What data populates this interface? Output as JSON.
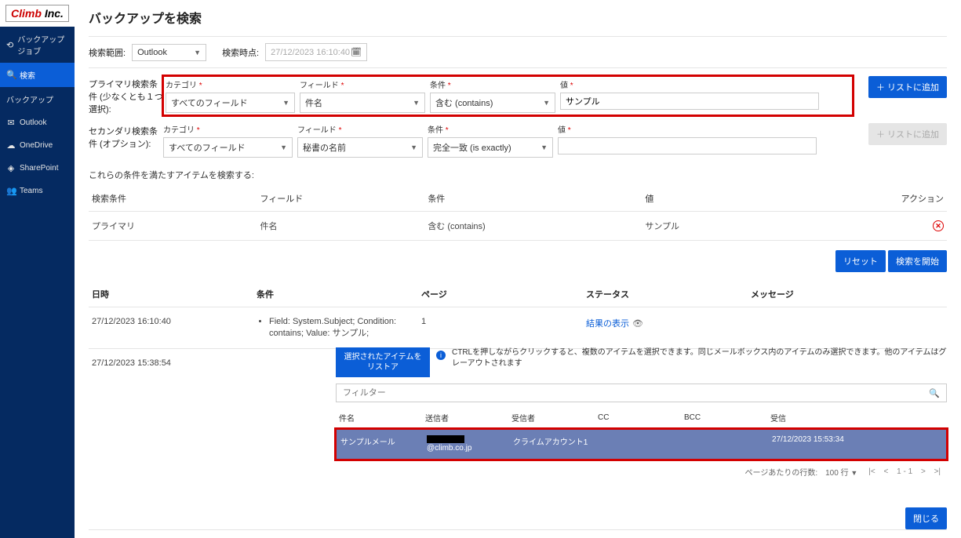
{
  "logo": {
    "red": "Climb",
    "black": "Inc."
  },
  "nav": {
    "backupJob": "バックアップジョブ",
    "search": "検索",
    "backup": "バックアップ",
    "outlook": "Outlook",
    "onedrive": "OneDrive",
    "sharepoint": "SharePoint",
    "teams": "Teams"
  },
  "pageTitle": "バックアップを検索",
  "searchScope": {
    "label": "検索範囲:",
    "value": "Outlook"
  },
  "searchTime": {
    "label": "検索時点:",
    "placeholder": "27/12/2023 16:10:40"
  },
  "primary": {
    "label": "プライマリ検索条件 (少なくとも１つ選択):",
    "catLabel": "カテゴリ",
    "catVal": "すべてのフィールド",
    "fldLabel": "フィールド",
    "fldVal": "件名",
    "condLabel": "条件",
    "condVal": "含む (contains)",
    "valLabel": "値",
    "valVal": "サンプル"
  },
  "secondary": {
    "label": "セカンダリ検索条件 (オプション):",
    "catLabel": "カテゴリ",
    "catVal": "すべてのフィールド",
    "fldLabel": "フィールド",
    "fldVal": "秘書の名前",
    "condLabel": "条件",
    "condVal": "完全一致 (is exactly)",
    "valLabel": "値",
    "valVal": ""
  },
  "addToList": "＋ リストに追加",
  "addToListDisabled": "＋ リストに追加",
  "condSection": "これらの条件を満たすアイテムを検索する:",
  "condHeaders": {
    "c1": "検索条件",
    "c2": "フィールド",
    "c3": "条件",
    "c4": "値",
    "c5": "アクション"
  },
  "condRow": {
    "c1": "プライマリ",
    "c2": "件名",
    "c3": "含む (contains)",
    "c4": "サンプル"
  },
  "resetBtn": "リセット",
  "startBtn": "検索を開始",
  "histHeaders": {
    "h1": "日時",
    "h2": "条件",
    "h3": "ページ",
    "h4": "ステータス",
    "h5": "メッセージ"
  },
  "histRows": [
    {
      "dt": "27/12/2023 16:10:40",
      "cond": "Field: System.Subject; Condition: contains; Value: サンプル;",
      "page": "1",
      "status": "結果の表示"
    },
    {
      "dt": "27/12/2023 15:38:54"
    }
  ],
  "results": {
    "restore": "選択されたアイテムをリストア",
    "info": "CTRLを押しながらクリックすると、複数のアイテムを選択できます。同じメールボックス内のアイテムのみ選択できます。他のアイテムはグレーアウトされます",
    "filterPlaceholder": "フィルター",
    "headers": {
      "r1": "件名",
      "r2": "送信者",
      "r3": "受信者",
      "r4": "CC",
      "r5": "BCC",
      "r6": "受信"
    },
    "row": {
      "subject": "サンプルメール",
      "senderDomain": "@climb.co.jp",
      "recipient": "クライムアカウント1",
      "received": "27/12/2023 15:53:34"
    },
    "pager": {
      "rowsLabel": "ページあたりの行数:",
      "rowsVal": "100 行",
      "range": "1 - 1"
    },
    "close": "閉じる"
  },
  "req": " *"
}
